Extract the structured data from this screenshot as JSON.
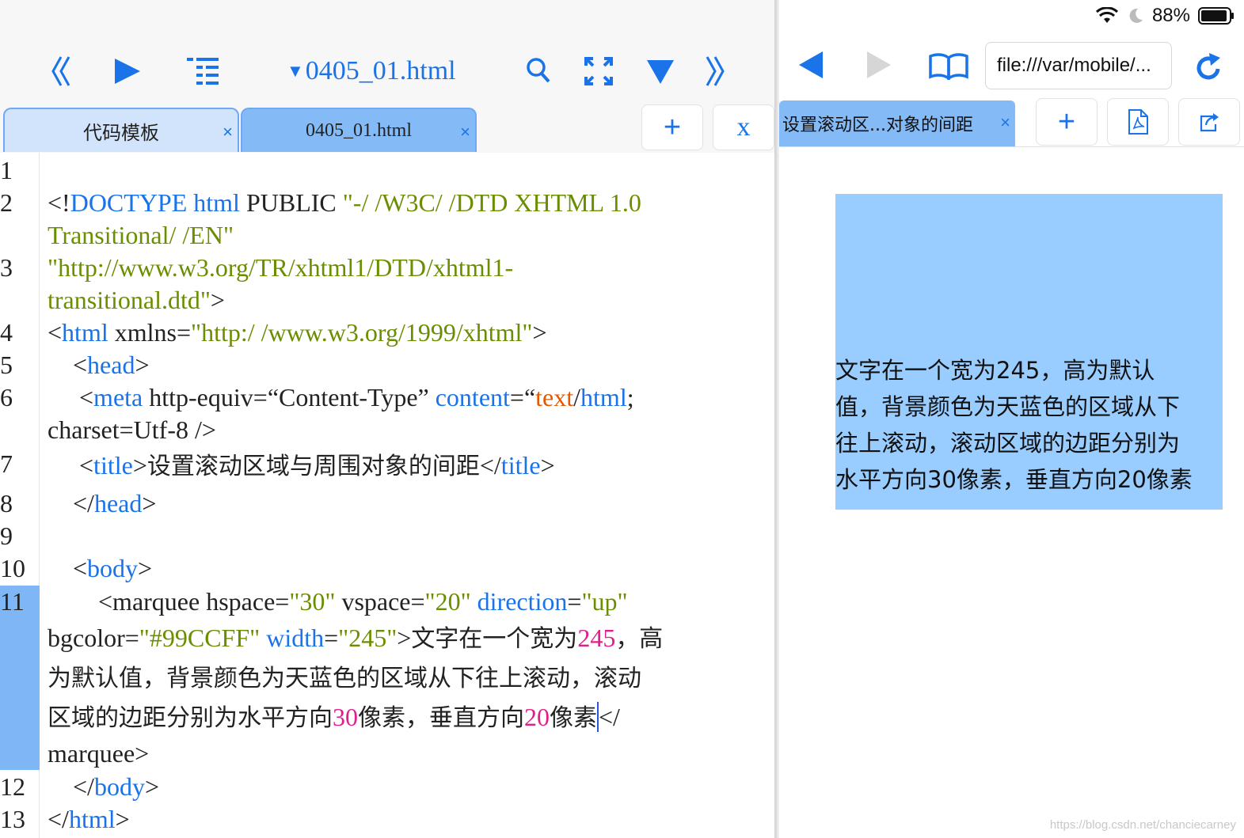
{
  "editor": {
    "file_title": "0405_01.html",
    "tabs": [
      {
        "label": "代码模板",
        "close": "×"
      },
      {
        "label": "0405_01.html",
        "close": "×"
      }
    ],
    "add_tab": "+",
    "close_all": "x",
    "line_numbers": [
      "1",
      "2",
      "3",
      "4",
      "5",
      "6",
      "7",
      "8",
      "9",
      "10",
      "11",
      "12",
      "13"
    ],
    "code": {
      "l2a_lt": "<!",
      "l2a_kw": "DOCTYPE html",
      "l2a_txt": " PUBLIC ",
      "l2a_str": "\"-/ /W3C/ /DTD XHTML 1.0",
      "l2b_str": "Transitional/ /EN\"",
      "l3a_str": "\"http://www.w3.org/TR/xhtml1/DTD/xhtml1-",
      "l3b_str": "transitional.dtd\"",
      "l3b_gt": ">",
      "l4_lt": "<",
      "l4_tag": "html",
      "l4_attr": " xmlns=",
      "l4_str": "\"http:/ /www.w3.org/1999/xhtml\"",
      "l4_gt": ">",
      "l5_lt": "    <",
      "l5_tag": "head",
      "l5_gt": ">",
      "l6_lt": "     <",
      "l6_tag": "meta",
      "l6_attr": " http-equiv=“Content-Type” ",
      "l6_attr2": "content",
      "l6_eq": "=“",
      "l6_val1": "text",
      "l6_slash": "/",
      "l6_val2": "html",
      "l6_semi": ";",
      "l6b": "charset=Utf-8 />",
      "l7_lt": "     <",
      "l7_tag": "title",
      "l7_gt": ">",
      "l7_text": "设置滚动区域与周围对象的间距",
      "l7_close_lt": "</",
      "l7_close_tag": "title",
      "l7_close_gt": ">",
      "l8_lt": "    </",
      "l8_tag": "head",
      "l8_gt": ">",
      "l10_lt": "    <",
      "l10_tag": "body",
      "l10_gt": ">",
      "l11a_pre": "        <marquee hspace=",
      "l11a_v1": "\"30\"",
      "l11a_mid": " vspace=",
      "l11a_v2": "\"20\"",
      "l11a_dir": " direction",
      "l11a_eq": "=",
      "l11a_v3": "\"up\"",
      "l11b_attr": "bgcolor=",
      "l11b_v1": "\"#99CCFF\"",
      "l11b_w": " width",
      "l11b_eq": "=",
      "l11b_v2": "\"245\"",
      "l11b_gt": ">",
      "l11b_text": "文字在一个宽为",
      "l11b_num": "245",
      "l11b_text2": "，高",
      "l11c_text": "为默认值，背景颜色为天蓝色的区域从下往上滚动，滚动",
      "l11d_text": "区域的边距分别为水平方向",
      "l11d_n1": "30",
      "l11d_text2": "像素，垂直方向",
      "l11d_n2": "20",
      "l11d_text3": "像素",
      "l11d_close": "</",
      "l11e": "marquee>",
      "l12_lt": "    </",
      "l12_tag": "body",
      "l12_gt": ">",
      "l13_lt": "</",
      "l13_tag": "html",
      "l13_gt": ">"
    }
  },
  "browser": {
    "status_battery": "88%",
    "url": "file:///var/mobile/...",
    "tab_label": "设置滚动区...对象的间距",
    "tab_close": "×",
    "add_tab": "+",
    "marquee_lines": [
      "文字在一个宽为245，高为默认",
      "值，背景颜色为天蓝色的区域从下",
      "往上滚动，滚动区域的边距分别为",
      "水平方向30像素，垂直方向20像素"
    ],
    "marquee_bg": "#99CCFF",
    "watermark": "https://blog.csdn.net/chanciecarney"
  },
  "colors": {
    "accent": "#1a73e8",
    "tag_blue": "#1a73e8",
    "string_green": "#6b8e00",
    "number_pink": "#e0208a",
    "value_orange": "#e15a00"
  }
}
